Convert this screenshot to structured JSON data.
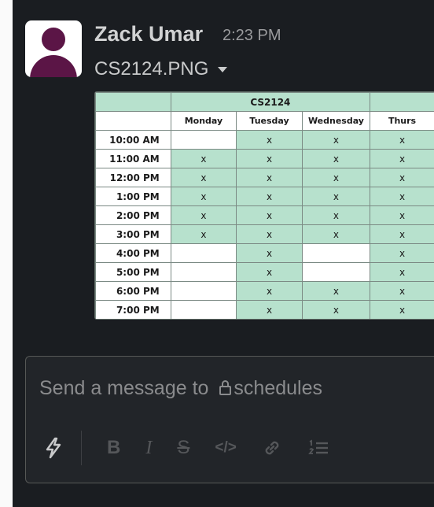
{
  "message": {
    "sender": "Zack Umar",
    "time": "2:23 PM",
    "file_name": "CS2124.PNG",
    "file_menu_icon": "caret-down-icon"
  },
  "attachment": {
    "title": "CS2124",
    "days": [
      "Monday",
      "Tuesday",
      "Wednesday",
      "Thurs"
    ],
    "mark": "x",
    "colors": {
      "busy": "#b7e1cd",
      "free": "#ffffff"
    },
    "rows": [
      {
        "time": "10:00 AM",
        "cells": [
          "",
          "x",
          "x",
          "x"
        ]
      },
      {
        "time": "11:00 AM",
        "cells": [
          "x",
          "x",
          "x",
          "x"
        ]
      },
      {
        "time": "12:00 PM",
        "cells": [
          "x",
          "x",
          "x",
          "x"
        ]
      },
      {
        "time": "1:00 PM",
        "cells": [
          "x",
          "x",
          "x",
          "x"
        ]
      },
      {
        "time": "2:00 PM",
        "cells": [
          "x",
          "x",
          "x",
          "x"
        ]
      },
      {
        "time": "3:00 PM",
        "cells": [
          "x",
          "x",
          "x",
          "x"
        ]
      },
      {
        "time": "4:00 PM",
        "cells": [
          "",
          "x",
          "",
          "x"
        ]
      },
      {
        "time": "5:00 PM",
        "cells": [
          "",
          "x",
          "",
          "x"
        ]
      },
      {
        "time": "6:00 PM",
        "cells": [
          "",
          "x",
          "x",
          "x"
        ]
      },
      {
        "time": "7:00 PM",
        "cells": [
          "",
          "x",
          "x",
          "x"
        ]
      }
    ]
  },
  "composer": {
    "placeholder_prefix": "Send a message to",
    "channel": "schedules",
    "channel_icon": "lock-icon",
    "toolbar": [
      {
        "name": "shortcuts-button",
        "icon": "lightning-icon"
      },
      {
        "name": "bold-button",
        "icon": "bold-icon",
        "glyph": "B"
      },
      {
        "name": "italic-button",
        "icon": "italic-icon",
        "glyph": "I"
      },
      {
        "name": "strikethrough-button",
        "icon": "strikethrough-icon",
        "glyph": "S"
      },
      {
        "name": "code-button",
        "icon": "code-icon",
        "glyph": "</>"
      },
      {
        "name": "link-button",
        "icon": "link-icon"
      },
      {
        "name": "numbered-list-button",
        "icon": "numbered-list-icon"
      }
    ]
  }
}
